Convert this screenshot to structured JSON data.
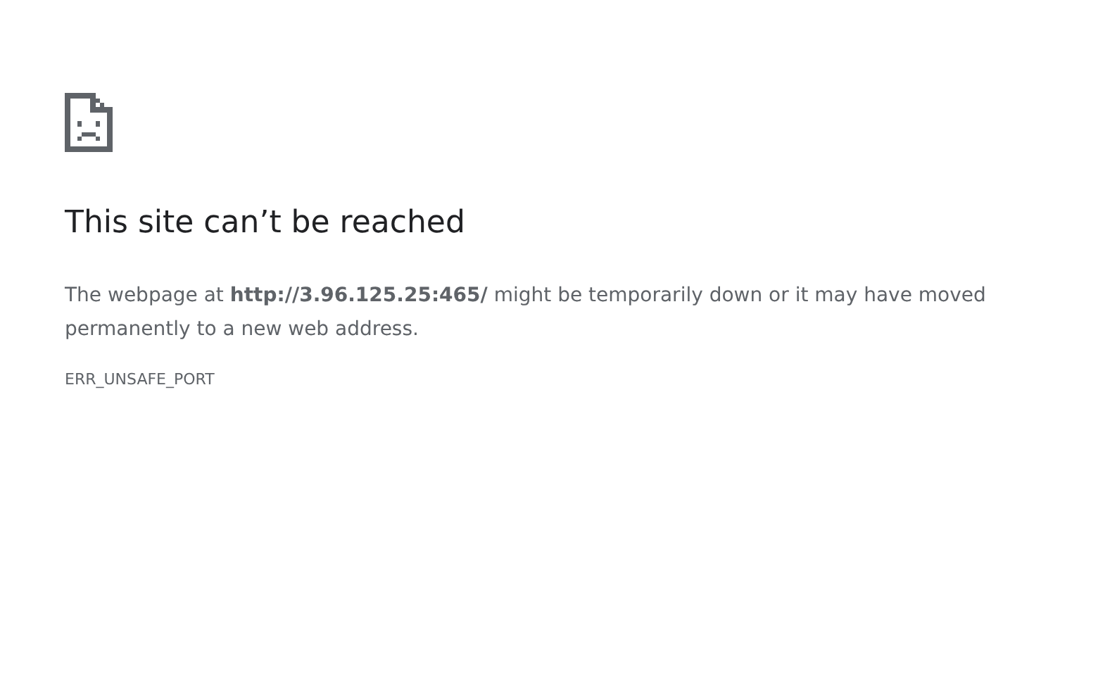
{
  "heading": "This site can’t be reached",
  "message": "The webpage at **http://3.96.125.25:465/** might be temporarily down or it may have moved permanently to a new web address.",
  "error_code": "ERR_UNSAFE_PORT"
}
